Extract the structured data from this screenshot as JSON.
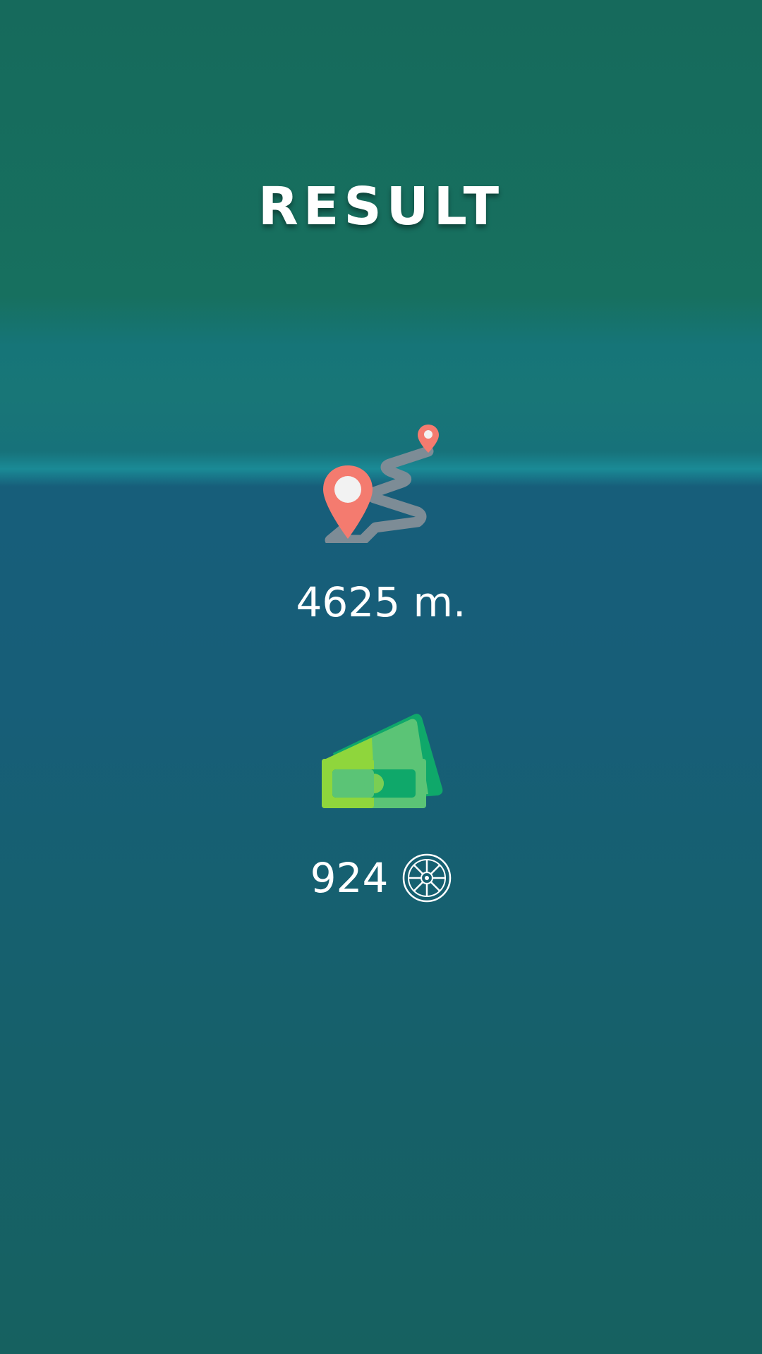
{
  "title": "RESULT",
  "distance": {
    "icon": "route-map-pins-icon",
    "value": "4625 m."
  },
  "coins": {
    "icon": "money-bills-icon",
    "value": "924",
    "currency_icon": "wheel-coin-icon"
  },
  "colors": {
    "pin": "#f47b6f",
    "road": "#7d8c96",
    "bill_light": "#8fd63c",
    "bill_dark": "#0fa86a"
  }
}
